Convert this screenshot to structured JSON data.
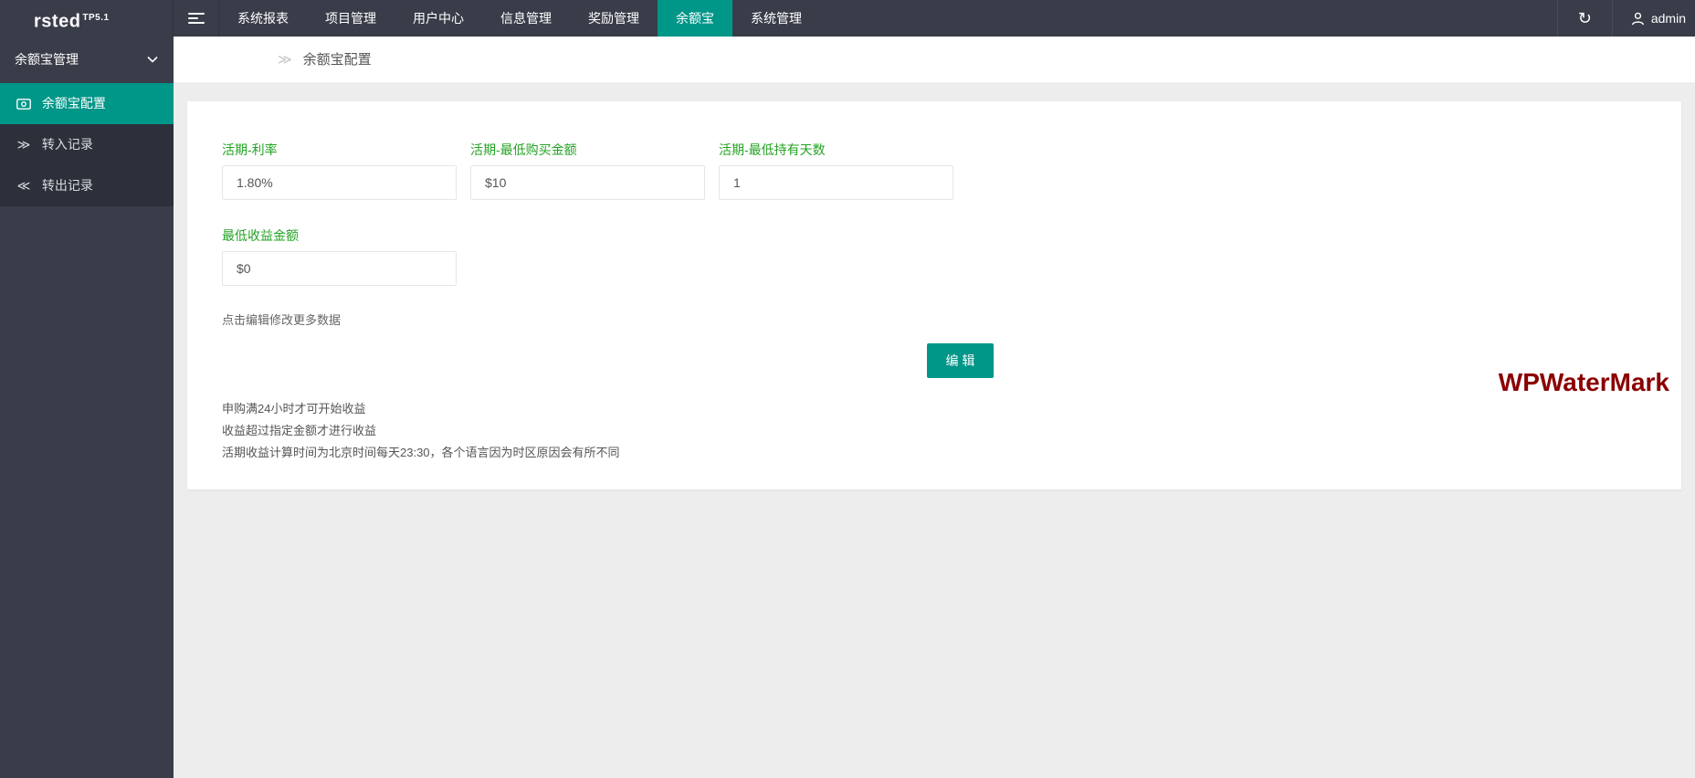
{
  "topbar": {
    "logo": "rsted",
    "logo_sup": "TP5.1",
    "menu": [
      {
        "label": "系统报表",
        "active": false
      },
      {
        "label": "项目管理",
        "active": false
      },
      {
        "label": "用户中心",
        "active": false
      },
      {
        "label": "信息管理",
        "active": false
      },
      {
        "label": "奖励管理",
        "active": false
      },
      {
        "label": "余额宝",
        "active": true
      },
      {
        "label": "系统管理",
        "active": false
      }
    ],
    "refresh_icon": "↻",
    "username": "admin"
  },
  "sidebar": {
    "group_label": "余额宝管理",
    "items": [
      {
        "label": "余额宝配置",
        "icon": "money-icon",
        "active": true
      },
      {
        "label": "转入记录",
        "icon": "double-right-icon",
        "glyph": "≫",
        "active": false
      },
      {
        "label": "转出记录",
        "icon": "double-left-icon",
        "glyph": "≪",
        "active": false
      }
    ]
  },
  "breadcrumb": {
    "separator": "≫",
    "current": "余额宝配置"
  },
  "form": {
    "fields": [
      {
        "label": "活期-利率",
        "value": "1.80%"
      },
      {
        "label": "活期-最低购买金额",
        "value": "$10"
      },
      {
        "label": "活期-最低持有天数",
        "value": "1"
      },
      {
        "label": "最低收益金额",
        "value": "$0"
      }
    ],
    "hint": "点击编辑修改更多数据",
    "edit_button_label": "编 辑",
    "notes": [
      "申购满24小时才可开始收益",
      "收益超过指定金额才进行收益",
      "活期收益计算时间为北京时间每天23:30，各个语言因为时区原因会有所不同"
    ]
  },
  "watermark": "WPWaterMark",
  "colors": {
    "accent_teal": "#009688",
    "label_green": "#23a323",
    "topbar_dark": "#393d49",
    "submenu_dark": "#2b303b",
    "watermark_red": "#8b0000",
    "content_bg": "#ededed"
  }
}
